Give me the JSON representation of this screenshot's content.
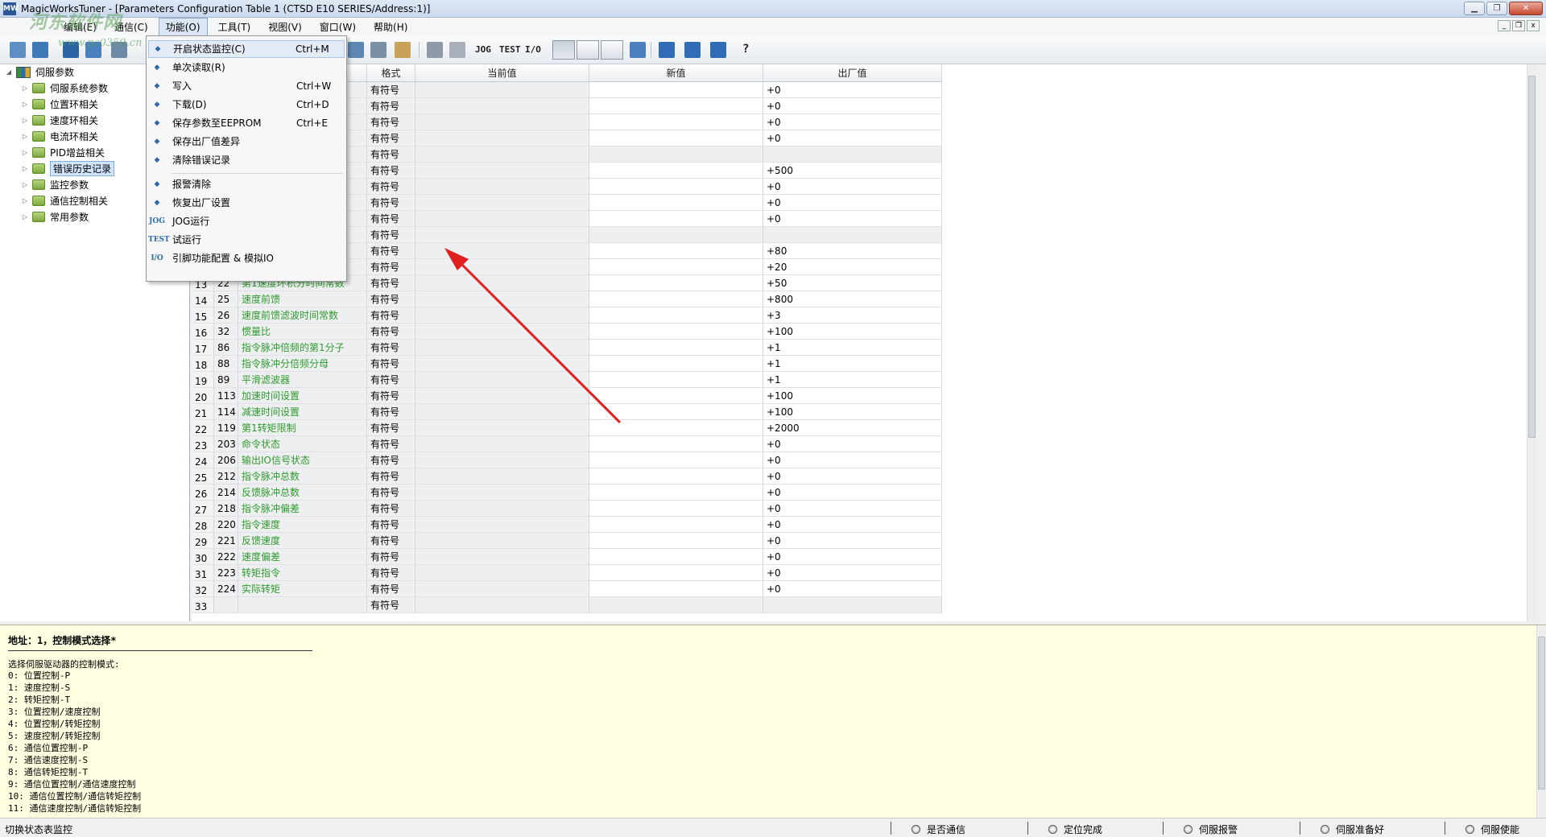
{
  "window": {
    "title": "MagicWorksTuner - [Parameters Configuration Table 1 (CTSD E10 SERIES/Address:1)]",
    "app_icon": "MW"
  },
  "watermark": {
    "text": "河东软件网",
    "url": "www.pc0359.cn"
  },
  "menubar": {
    "items": [
      {
        "label": "编辑(E)"
      },
      {
        "label": "通信(C)"
      },
      {
        "label": "功能(O)"
      },
      {
        "label": "工具(T)"
      },
      {
        "label": "视图(V)"
      },
      {
        "label": "窗口(W)"
      },
      {
        "label": "帮助(H)"
      }
    ]
  },
  "toolbar": {
    "jog": "JOG",
    "test": "TEST",
    "io": "I/O",
    "help": "?"
  },
  "dropdown": {
    "items": [
      {
        "icon": "monitor-icon",
        "label": "开启状态监控(C)",
        "shortcut": "Ctrl+M"
      },
      {
        "icon": "read-icon",
        "label": "单次读取(R)",
        "shortcut": ""
      },
      {
        "icon": "write-icon",
        "label": "写入",
        "shortcut": "Ctrl+W"
      },
      {
        "icon": "download-icon",
        "label": "下载(D)",
        "shortcut": "Ctrl+D"
      },
      {
        "icon": "eeprom-icon",
        "label": "保存参数至EEPROM",
        "shortcut": "Ctrl+E"
      },
      {
        "icon": "diff-icon",
        "label": "保存出厂值差异",
        "shortcut": ""
      },
      {
        "icon": "clear-error-icon",
        "label": "清除错误记录",
        "shortcut": ""
      },
      {
        "icon": "alarm-clear-icon",
        "label": "报警清除",
        "shortcut": ""
      },
      {
        "icon": "restore-icon",
        "label": "恢复出厂设置",
        "shortcut": ""
      },
      {
        "icon": "jog-icon",
        "icon_text": "JOG",
        "label": "JOG运行",
        "shortcut": ""
      },
      {
        "icon": "test-icon",
        "icon_text": "TEST",
        "label": "试运行",
        "shortcut": ""
      },
      {
        "icon": "io-icon",
        "icon_text": "I/O",
        "label": "引脚功能配置 & 模拟IO",
        "shortcut": ""
      }
    ]
  },
  "tree": {
    "root": "伺服参数",
    "children": [
      {
        "label": "伺服系统参数"
      },
      {
        "label": "位置环相关"
      },
      {
        "label": "速度环相关"
      },
      {
        "label": "电流环相关"
      },
      {
        "label": "PID增益相关"
      },
      {
        "label": "错误历史记录"
      },
      {
        "label": "监控参数"
      },
      {
        "label": "通信控制相关"
      },
      {
        "label": "常用参数"
      }
    ]
  },
  "grid": {
    "headers": {
      "format": "格式",
      "current": "当前值",
      "new": "新值",
      "factory": "出厂值"
    },
    "rows": [
      {
        "rn": "",
        "addr": "",
        "name": "",
        "fmt": "有符号",
        "fac": "+0"
      },
      {
        "rn": "",
        "addr": "",
        "name": "",
        "fmt": "有符号",
        "fac": "+0"
      },
      {
        "rn": "",
        "addr": "",
        "name": "",
        "fmt": "有符号",
        "fac": "+0"
      },
      {
        "rn": "",
        "addr": "",
        "name": "",
        "fmt": "有符号",
        "fac": "+0"
      },
      {
        "rn": "",
        "addr": "",
        "name": "",
        "fmt": "有符号",
        "fac": ""
      },
      {
        "rn": "",
        "addr": "",
        "name": "",
        "fmt": "有符号",
        "fac": "+500"
      },
      {
        "rn": "",
        "addr": "",
        "name": "",
        "fmt": "有符号",
        "fac": "+0"
      },
      {
        "rn": "",
        "addr": "",
        "name": "",
        "fmt": "有符号",
        "fac": "+0"
      },
      {
        "rn": "",
        "addr": "",
        "name": "",
        "fmt": "有符号",
        "fac": "+0"
      },
      {
        "rn": "",
        "addr": "",
        "name": "",
        "fmt": "有符号",
        "fac": ""
      },
      {
        "rn": "",
        "addr": "",
        "name": "",
        "fmt": "有符号",
        "fac": "+80"
      },
      {
        "rn": "",
        "addr": "",
        "name": "",
        "fmt": "有符号",
        "fac": "+20"
      },
      {
        "rn": "13",
        "addr": "22",
        "name": "第1速度环积分时间常数",
        "fmt": "有符号",
        "fac": "+50"
      },
      {
        "rn": "14",
        "addr": "25",
        "name": "速度前馈",
        "fmt": "有符号",
        "fac": "+800"
      },
      {
        "rn": "15",
        "addr": "26",
        "name": "速度前馈滤波时间常数",
        "fmt": "有符号",
        "fac": "+3"
      },
      {
        "rn": "16",
        "addr": "32",
        "name": "惯量比",
        "fmt": "有符号",
        "fac": "+100"
      },
      {
        "rn": "17",
        "addr": "86",
        "name": "指令脉冲倍频的第1分子",
        "fmt": "有符号",
        "fac": "+1"
      },
      {
        "rn": "18",
        "addr": "88",
        "name": "指令脉冲分倍频分母",
        "fmt": "有符号",
        "fac": "+1"
      },
      {
        "rn": "19",
        "addr": "89",
        "name": "平滑滤波器",
        "fmt": "有符号",
        "fac": "+1"
      },
      {
        "rn": "20",
        "addr": "113",
        "name": "加速时间设置",
        "fmt": "有符号",
        "fac": "+100"
      },
      {
        "rn": "21",
        "addr": "114",
        "name": "减速时间设置",
        "fmt": "有符号",
        "fac": "+100"
      },
      {
        "rn": "22",
        "addr": "119",
        "name": "第1转矩限制",
        "fmt": "有符号",
        "fac": "+2000"
      },
      {
        "rn": "23",
        "addr": "203",
        "name": "命令状态",
        "fmt": "有符号",
        "fac": "+0"
      },
      {
        "rn": "24",
        "addr": "206",
        "name": "输出IO信号状态",
        "fmt": "有符号",
        "fac": "+0"
      },
      {
        "rn": "25",
        "addr": "212",
        "name": "指令脉冲总数",
        "fmt": "有符号",
        "fac": "+0"
      },
      {
        "rn": "26",
        "addr": "214",
        "name": "反馈脉冲总数",
        "fmt": "有符号",
        "fac": "+0"
      },
      {
        "rn": "27",
        "addr": "218",
        "name": "指令脉冲偏差",
        "fmt": "有符号",
        "fac": "+0"
      },
      {
        "rn": "28",
        "addr": "220",
        "name": "指令速度",
        "fmt": "有符号",
        "fac": "+0"
      },
      {
        "rn": "29",
        "addr": "221",
        "name": "反馈速度",
        "fmt": "有符号",
        "fac": "+0"
      },
      {
        "rn": "30",
        "addr": "222",
        "name": "速度偏差",
        "fmt": "有符号",
        "fac": "+0"
      },
      {
        "rn": "31",
        "addr": "223",
        "name": "转矩指令",
        "fmt": "有符号",
        "fac": "+0"
      },
      {
        "rn": "32",
        "addr": "224",
        "name": "实际转矩",
        "fmt": "有符号",
        "fac": "+0"
      },
      {
        "rn": "33",
        "addr": "",
        "name": "",
        "fmt": "有符号",
        "fac": ""
      }
    ]
  },
  "description": {
    "heading": "地址：1，控制模式选择*",
    "intro": "选择伺服驱动器的控制模式:",
    "lines": [
      "0: 位置控制-P",
      "1: 速度控制-S",
      "2: 转矩控制-T",
      "3: 位置控制/速度控制",
      "4: 位置控制/转矩控制",
      "5: 速度控制/转矩控制",
      "6: 通信位置控制-P",
      "7: 通信速度控制-S",
      "8: 通信转矩控制-T",
      "9: 通信位置控制/通信速度控制",
      "10: 通信位置控制/通信转矩控制",
      "11: 通信速度控制/通信转矩控制"
    ]
  },
  "statusbar": {
    "left": "切换状态表监控",
    "indicators": [
      {
        "label": "是否通信"
      },
      {
        "label": "定位完成"
      },
      {
        "label": "伺服报警"
      },
      {
        "label": "伺服准备好"
      },
      {
        "label": "伺服使能"
      }
    ]
  },
  "colors": {
    "param_name": "#2e9b2e",
    "desc_bg": "#ffffe1",
    "arrow": "#e02020",
    "menu_highlight": "#e2ebf6"
  }
}
